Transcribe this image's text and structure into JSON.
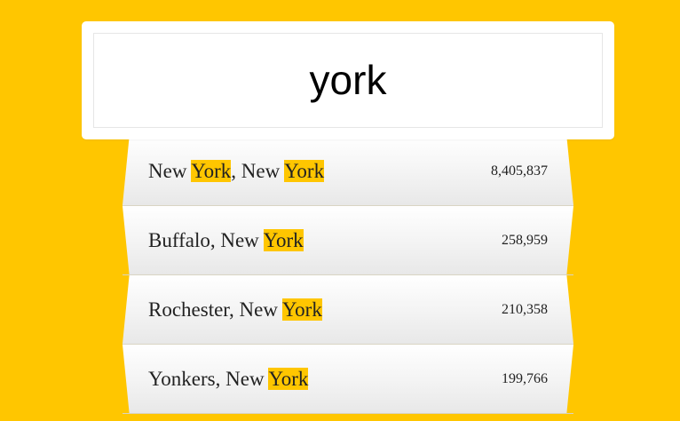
{
  "search": {
    "value": "york",
    "placeholder": ""
  },
  "colors": {
    "background": "#ffc600",
    "highlight": "#ffc600",
    "panel": "#ffffff",
    "text": "#222222"
  },
  "suggestions": [
    {
      "parts": [
        "New ",
        "York",
        ", New ",
        "York"
      ],
      "population": "8,405,837"
    },
    {
      "parts": [
        "Buffalo, New ",
        "York"
      ],
      "population": "258,959"
    },
    {
      "parts": [
        "Rochester, New ",
        "York"
      ],
      "population": "210,358"
    },
    {
      "parts": [
        "Yonkers, New ",
        "York"
      ],
      "population": "199,766"
    }
  ]
}
